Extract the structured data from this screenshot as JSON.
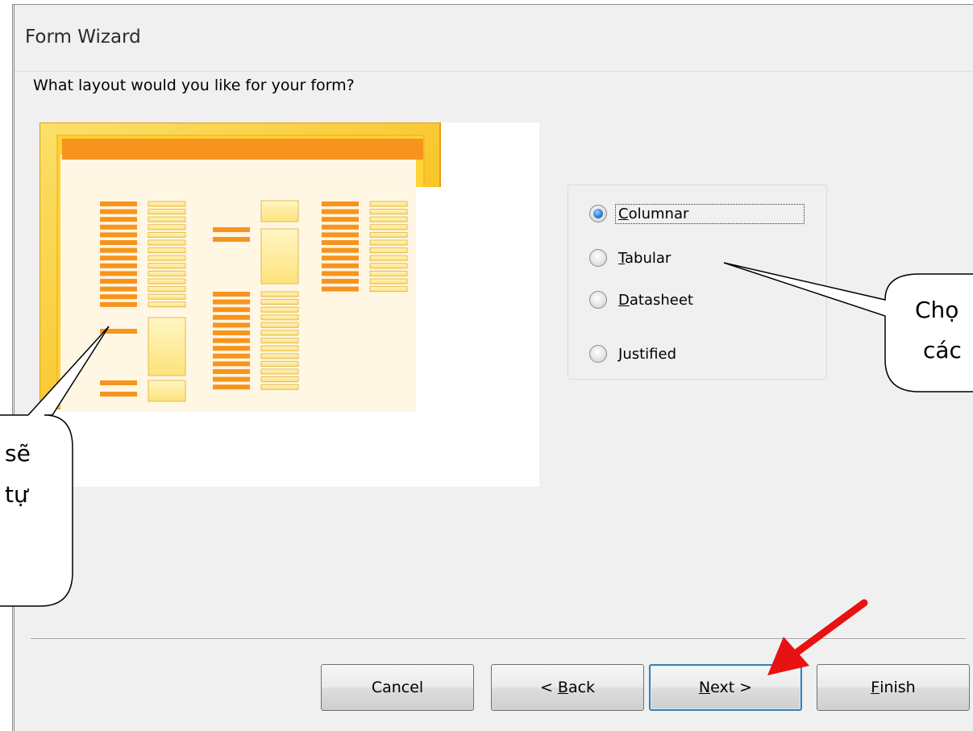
{
  "dialog": {
    "title": "Form Wizard",
    "question": "What layout would you like for your form?"
  },
  "layout_options": [
    {
      "key": "columnar",
      "accel": "C",
      "rest": "olumnar",
      "checked": true
    },
    {
      "key": "tabular",
      "accel": "T",
      "rest": "abular",
      "checked": false
    },
    {
      "key": "datasheet",
      "accel": "D",
      "rest": "atasheet",
      "checked": false
    },
    {
      "key": "justified",
      "accel": "J",
      "rest": "ustified",
      "checked": false
    }
  ],
  "buttons": {
    "cancel": "Cancel",
    "back_prefix": "< ",
    "back_accel": "B",
    "back_rest": "ack",
    "next_accel": "N",
    "next_rest": "ext >",
    "finish_accel": "F",
    "finish_rest": "inish"
  },
  "callouts": {
    "left_line1": "sẽ",
    "left_line2": "tự",
    "right_line1": "Chọ",
    "right_line2": "các"
  },
  "colors": {
    "accent_orange": "#f7941d",
    "frame_yellow": "#f9c10a",
    "arrow_red": "#e81212",
    "default_button_border": "#3c7fb1"
  }
}
